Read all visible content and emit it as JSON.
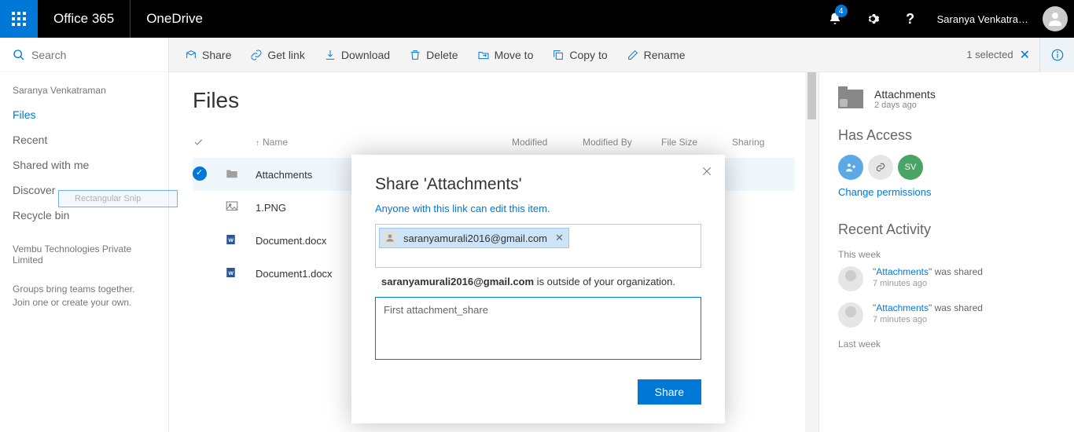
{
  "header": {
    "brand": "Office 365",
    "app": "OneDrive",
    "notif_count": "4",
    "user": "Saranya Venkatra…"
  },
  "search": {
    "placeholder": "Search"
  },
  "nav": {
    "owner": "Saranya Venkatraman",
    "items": [
      "Files",
      "Recent",
      "Shared with me",
      "Discover",
      "Recycle bin"
    ],
    "org": "Vembu Technologies Private Limited",
    "hint1": "Groups bring teams together.",
    "hint2": "Join one or create your own.",
    "snip_label": "Rectangular Snip"
  },
  "cmd": {
    "share": "Share",
    "getlink": "Get link",
    "download": "Download",
    "delete": "Delete",
    "moveto": "Move to",
    "copyto": "Copy to",
    "rename": "Rename",
    "selected": "1 selected"
  },
  "files": {
    "title": "Files",
    "cols": {
      "name": "Name",
      "modified": "Modified",
      "modby": "Modified By",
      "size": "File Size",
      "sharing": "Sharing"
    },
    "rows": [
      {
        "name": "Attachments",
        "type": "folder",
        "selected": true
      },
      {
        "name": "1.PNG",
        "type": "img"
      },
      {
        "name": "Document.docx",
        "type": "word"
      },
      {
        "name": "Document1.docx",
        "type": "word"
      }
    ]
  },
  "details": {
    "item": "Attachments",
    "time": "2 days ago",
    "access_title": "Has Access",
    "sv": "SV",
    "change": "Change permissions",
    "recent_title": "Recent Activity",
    "this_week": "This week",
    "last_week": "Last week",
    "acts": [
      {
        "fn": "Attachments",
        "txt": "\" was shared",
        "tm": "7 minutes ago"
      },
      {
        "fn": "Attachments",
        "txt": "\" was shared",
        "tm": "7 minutes ago"
      }
    ]
  },
  "dialog": {
    "title": "Share 'Attachments'",
    "perm": "Anyone with this link can edit this item.",
    "chip_email": "saranyamurali2016@gmail.com",
    "warn_email": "saranyamurali2016@gmail.com",
    "warn_rest": " is outside of your organization.",
    "msg": "First attachment_share",
    "share": "Share"
  }
}
